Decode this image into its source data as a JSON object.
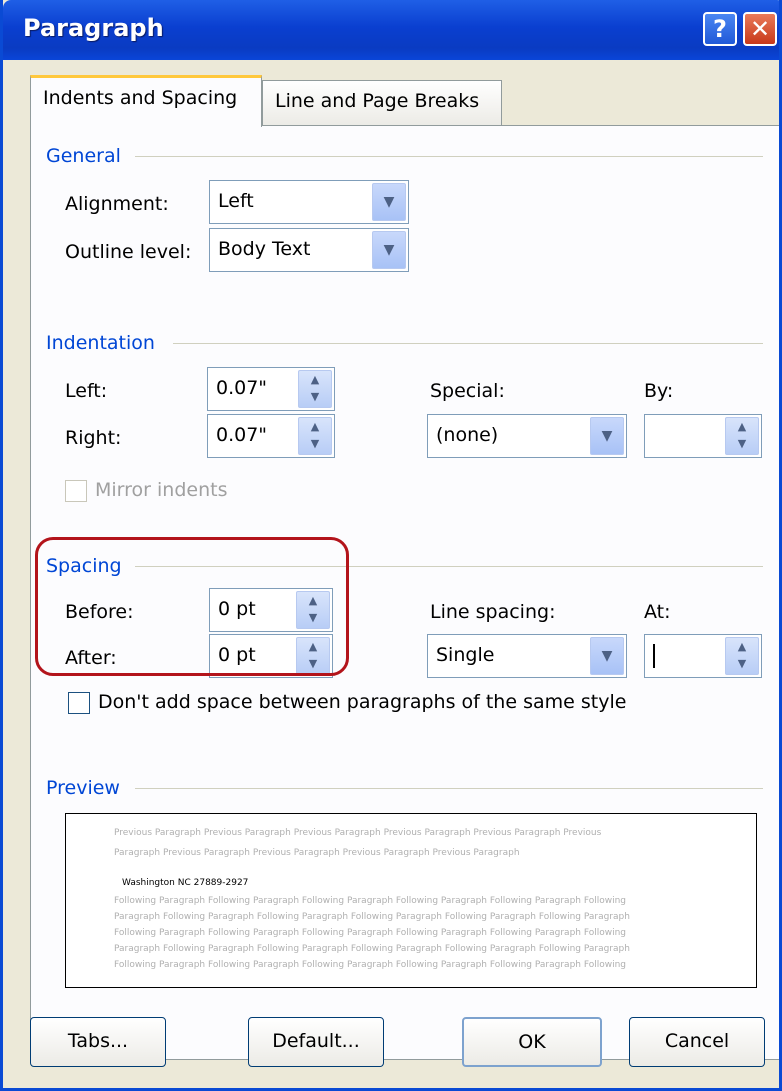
{
  "window": {
    "title": "Paragraph",
    "help_glyph": "?",
    "close_glyph": "✕"
  },
  "tabs": [
    {
      "label": "Indents and Spacing",
      "active": true
    },
    {
      "label": "Line and Page Breaks",
      "active": false
    }
  ],
  "general": {
    "title": "General",
    "alignment_label": "Alignment:",
    "alignment_value": "Left",
    "outline_label": "Outline level:",
    "outline_value": "Body Text"
  },
  "indentation": {
    "title": "Indentation",
    "left_label": "Left:",
    "left_value": "0.07\"",
    "right_label": "Right:",
    "right_value": "0.07\"",
    "special_label": "Special:",
    "special_value": "(none)",
    "by_label": "By:",
    "by_value": "",
    "mirror_label": "Mirror indents"
  },
  "spacing": {
    "title": "Spacing",
    "before_label": "Before:",
    "before_value": "0 pt",
    "after_label": "After:",
    "after_value": "0 pt",
    "line_spacing_label": "Line spacing:",
    "line_spacing_value": "Single",
    "at_label": "At:",
    "at_value": "",
    "dont_add_label": "Don't add space between paragraphs of the same style"
  },
  "preview": {
    "title": "Preview",
    "previous_lines": [
      "Previous Paragraph Previous Paragraph Previous Paragraph Previous Paragraph Previous Paragraph Previous",
      "Paragraph Previous Paragraph Previous Paragraph Previous Paragraph Previous Paragraph"
    ],
    "main_text": "Washington NC 27889-2927",
    "following_lines": [
      "Following Paragraph Following Paragraph Following Paragraph Following Paragraph Following Paragraph Following",
      "Paragraph Following Paragraph Following Paragraph Following Paragraph Following Paragraph Following Paragraph",
      "Following Paragraph Following Paragraph Following Paragraph Following Paragraph Following Paragraph Following",
      "Paragraph Following Paragraph Following Paragraph Following Paragraph Following Paragraph Following Paragraph",
      "Following Paragraph Following Paragraph Following Paragraph Following Paragraph Following Paragraph Following"
    ]
  },
  "buttons": {
    "tabs": "Tabs...",
    "default": "Default...",
    "ok": "OK",
    "cancel": "Cancel"
  },
  "colors": {
    "title_bar": "#0a3fd0",
    "group_title": "#0046d5",
    "highlight": "#b3141b",
    "dialog_bg": "#ece9d8"
  },
  "icons": {
    "dropdown": "chevron-down-icon",
    "spinner": "spin-arrows-icon"
  }
}
